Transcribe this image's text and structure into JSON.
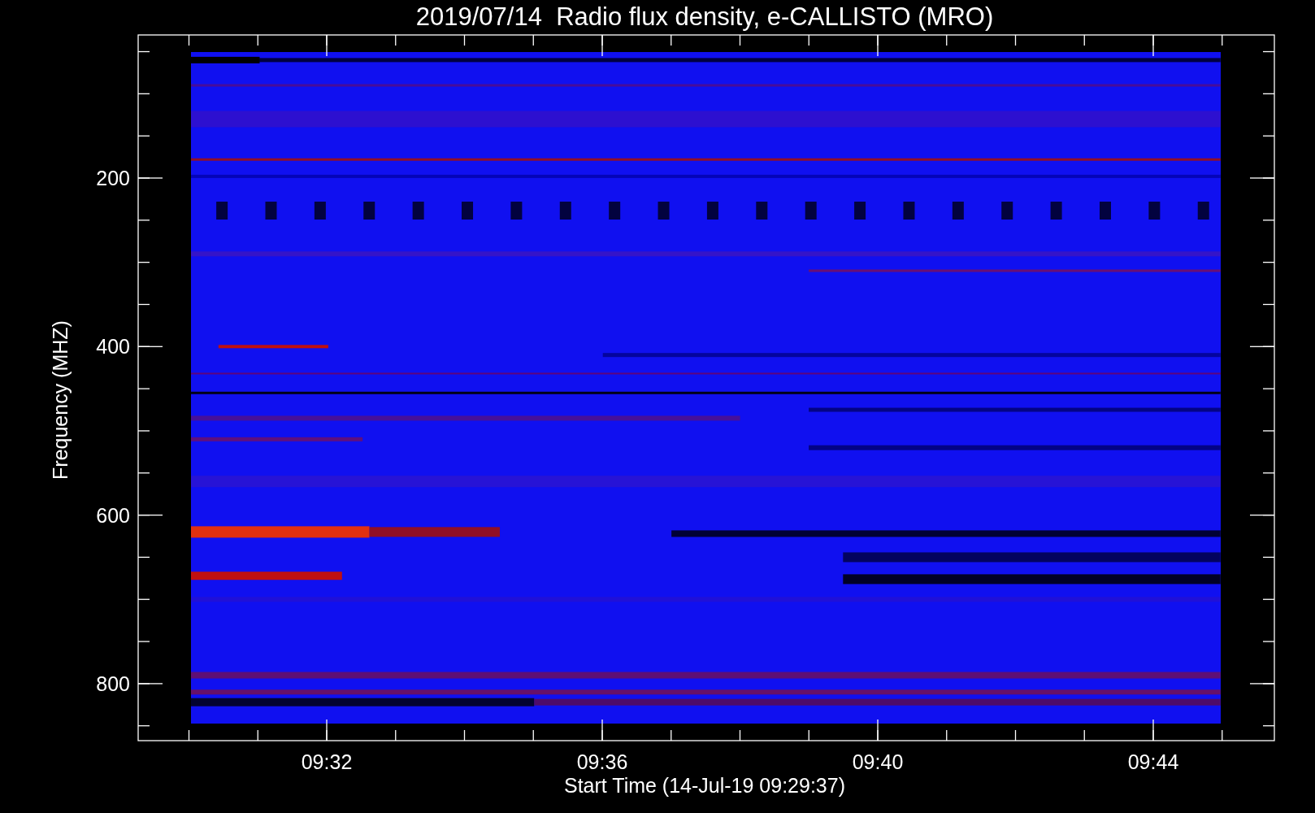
{
  "title": "2019/07/14  Radio flux density, e-CALLISTO (MRO)",
  "y_axis": {
    "label": "Frequency (MHZ)",
    "ticks": [
      "200",
      "400",
      "600",
      "800"
    ]
  },
  "x_axis": {
    "label": "Start Time (14-Jul-19 09:29:37)",
    "ticks": [
      "09:32",
      "09:36",
      "09:40",
      "09:44"
    ]
  }
}
